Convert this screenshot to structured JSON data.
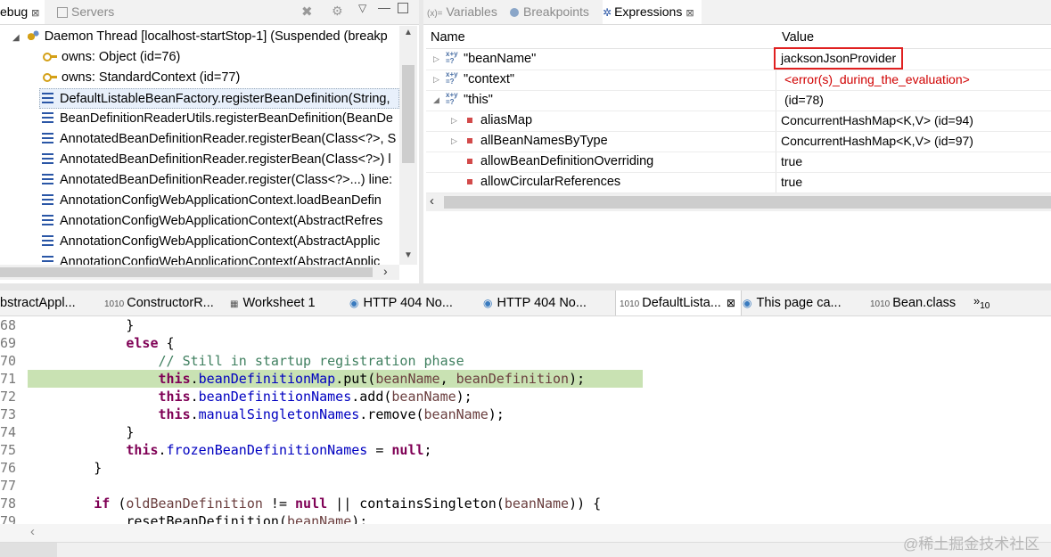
{
  "debug_view": {
    "tabs": [
      {
        "label": "ebug",
        "active": true
      },
      {
        "label": "Servers",
        "active": false
      }
    ],
    "thread": "Daemon Thread [localhost-startStop-1] (Suspended (breakp",
    "owns": [
      "owns: Object  (id=76)",
      "owns: StandardContext  (id=77)"
    ],
    "frames": [
      "DefaultListableBeanFactory.registerBeanDefinition(String,",
      "BeanDefinitionReaderUtils.registerBeanDefinition(BeanDe",
      "AnnotatedBeanDefinitionReader.registerBean(Class<?>, S",
      "AnnotatedBeanDefinitionReader.registerBean(Class<?>) l",
      "AnnotatedBeanDefinitionReader.register(Class<?>...) line:",
      "AnnotationConfigWebApplicationContext.loadBeanDefin",
      "AnnotationConfigWebApplicationContext(AbstractRefres",
      "AnnotationConfigWebApplicationContext(AbstractApplic",
      "AnnotationConfigWebApplicationContext(AbstractApplic"
    ]
  },
  "expressions_view": {
    "tabs": [
      {
        "label": "Variables",
        "active": false
      },
      {
        "label": "Breakpoints",
        "active": false
      },
      {
        "label": "Expressions",
        "active": true
      }
    ],
    "columns": [
      "Name",
      "Value"
    ],
    "rows": [
      {
        "name": "\"beanName\"",
        "value": "jacksonJsonProvider"
      },
      {
        "name": "\"context\"",
        "value": "<error(s)_during_the_evaluation>"
      },
      {
        "name": "\"this\"",
        "value": "(id=78)"
      },
      {
        "name": "aliasMap",
        "value": "ConcurrentHashMap<K,V>  (id=94)"
      },
      {
        "name": "allBeanNamesByType",
        "value": "ConcurrentHashMap<K,V>  (id=97)"
      },
      {
        "name": "allowBeanDefinitionOverriding",
        "value": "true"
      },
      {
        "name": "allowCircularReferences",
        "value": "true"
      }
    ]
  },
  "editor_tabs": [
    "bstractAppl...",
    "ConstructorR...",
    "Worksheet 1",
    "HTTP 404 No...",
    "HTTP 404 No...",
    "DefaultLista...",
    "This page ca...",
    "Bean.class"
  ],
  "overflow_label": "»",
  "overflow_count": "10",
  "code_lines": [
    {
      "n": "68",
      "t": "            }"
    },
    {
      "n": "69",
      "t": "            else {"
    },
    {
      "n": "70",
      "t": "                // Still in startup registration phase"
    },
    {
      "n": "71",
      "t": "                this.beanDefinitionMap.put(beanName, beanDefinition);"
    },
    {
      "n": "72",
      "t": "                this.beanDefinitionNames.add(beanName);"
    },
    {
      "n": "73",
      "t": "                this.manualSingletonNames.remove(beanName);"
    },
    {
      "n": "74",
      "t": "            }"
    },
    {
      "n": "75",
      "t": "            this.frozenBeanDefinitionNames = null;"
    },
    {
      "n": "76",
      "t": "        }"
    },
    {
      "n": "77",
      "t": ""
    },
    {
      "n": "78",
      "t": "        if (oldBeanDefinition != null || containsSingleton(beanName)) {"
    },
    {
      "n": "79",
      "t": "            resetBeanDefinition(beanName);"
    }
  ],
  "watermark": "@稀土掘金技术社区",
  "colors": {
    "highlight_line": "#c9e2b3",
    "highlight_box": "#e02020",
    "keyword": "#7f0055",
    "field": "#0000c0"
  }
}
